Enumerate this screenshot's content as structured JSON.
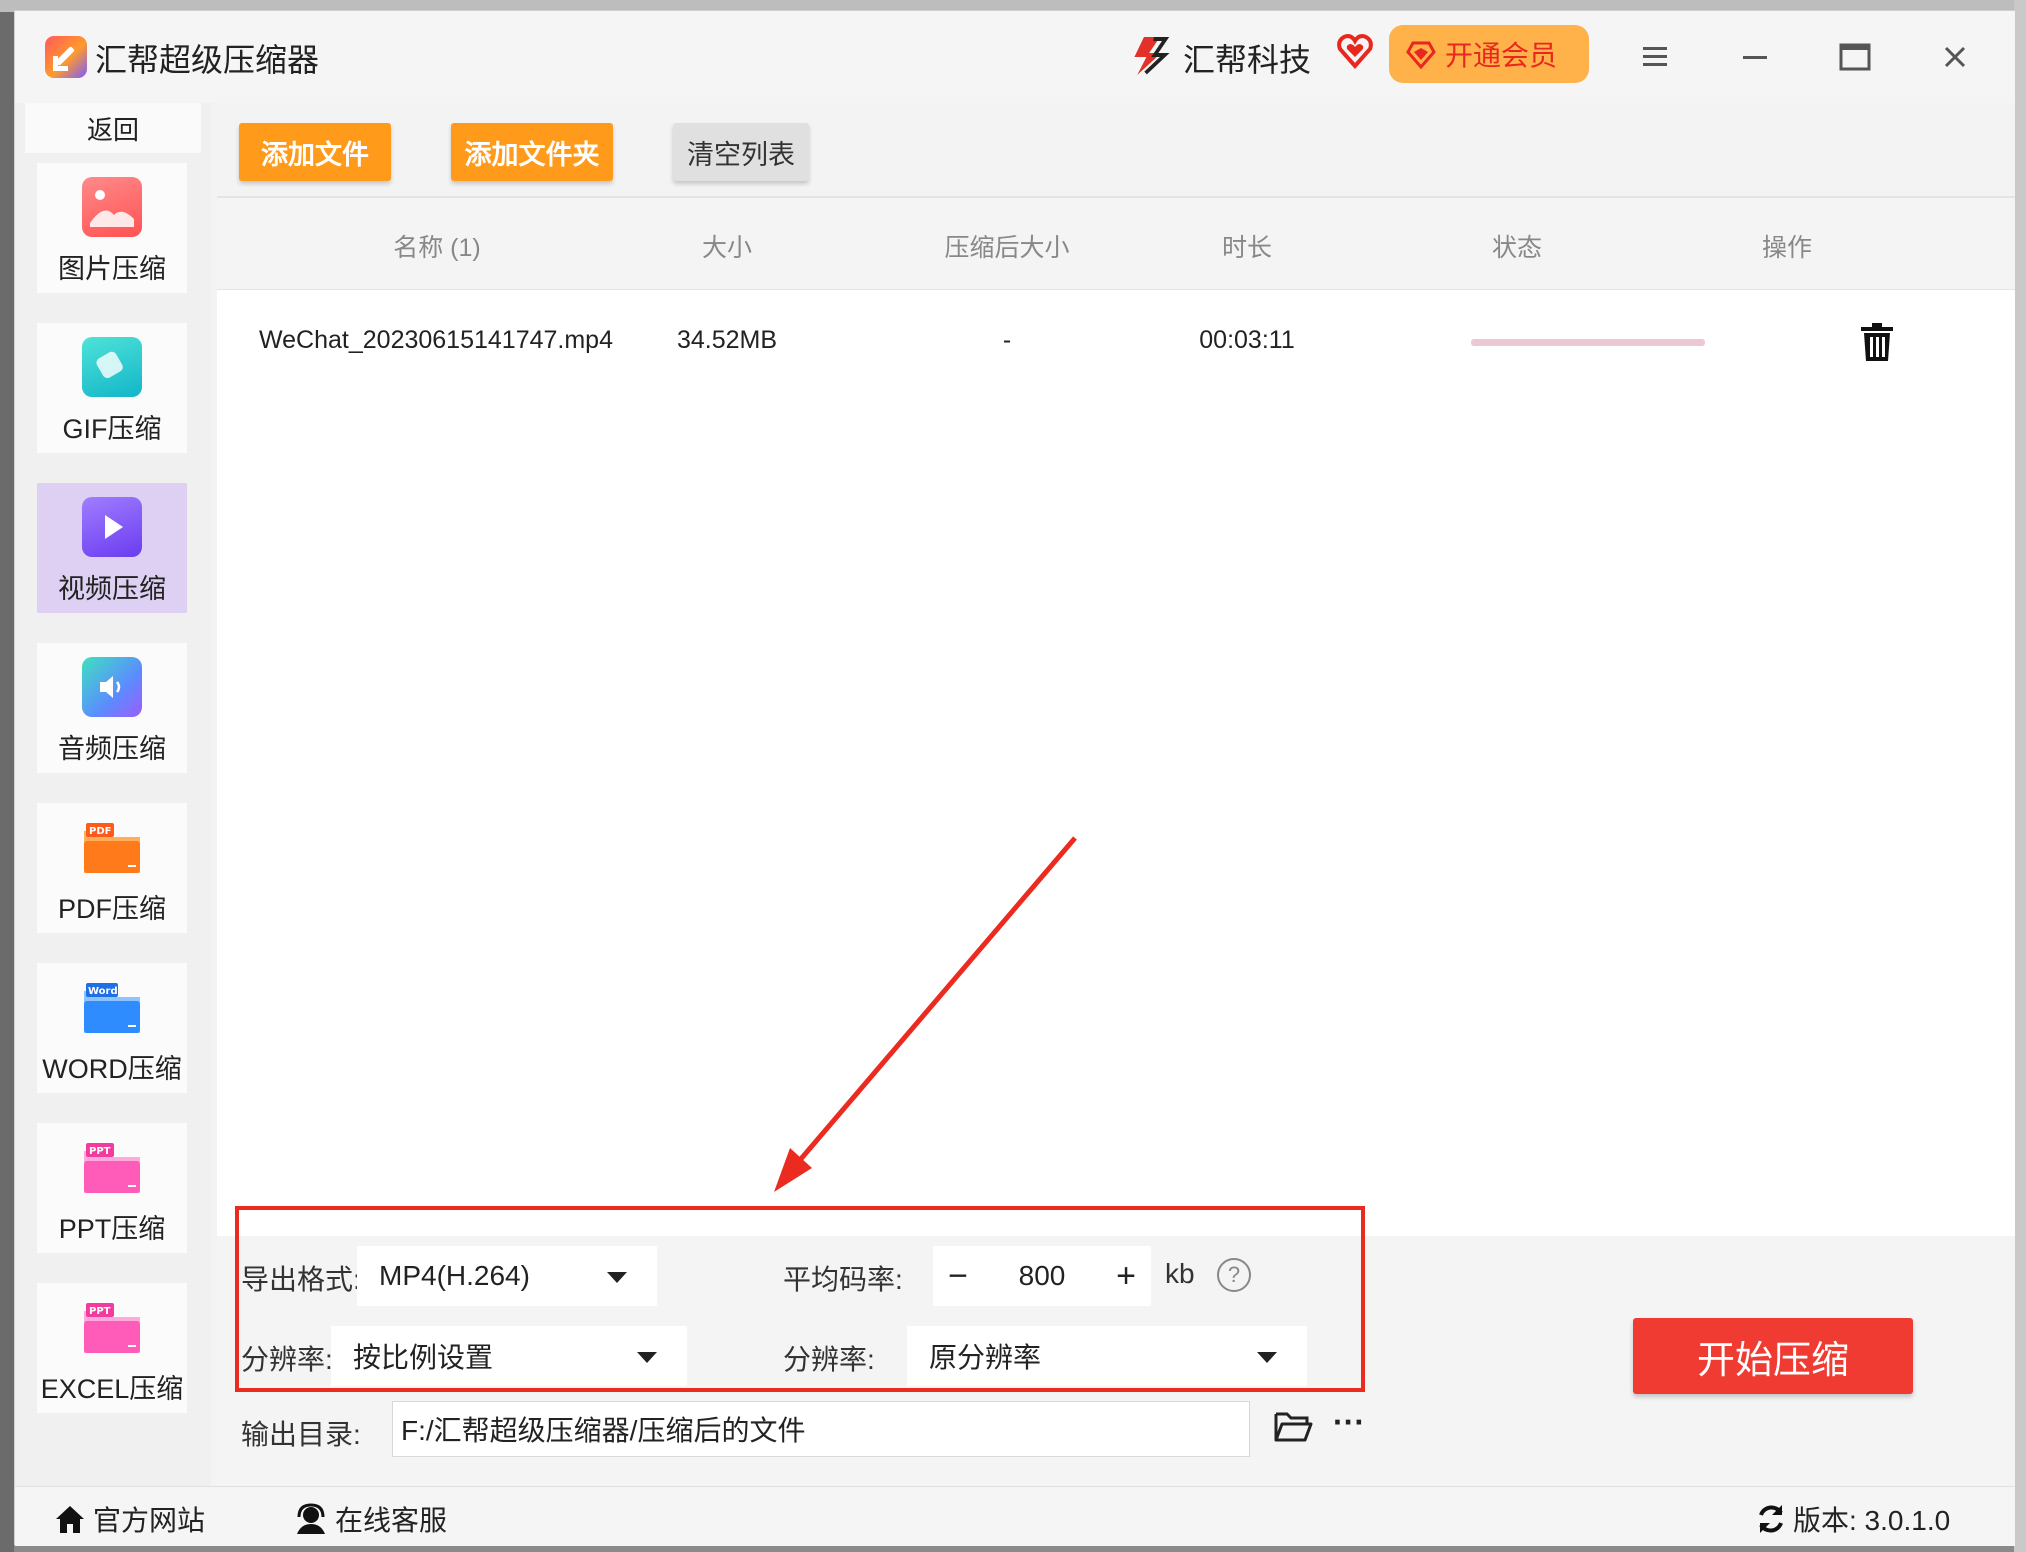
{
  "window": {
    "app_title": "汇帮超级压缩器",
    "brand_name": "汇帮科技",
    "vip_label": "开通会员",
    "icons": {
      "app": "compress-logo-icon",
      "brand": "brand-logo-icon",
      "heart": "heart-icon",
      "vip": "diamond-icon",
      "menu": "menu-icon",
      "minimize": "minimize-icon",
      "maximize": "maximize-icon",
      "close": "close-icon"
    }
  },
  "sidebar": {
    "back_label": "返回",
    "items": [
      {
        "label": "图片压缩",
        "icon": "image-icon",
        "color": "#ff6b6b"
      },
      {
        "label": "GIF压缩",
        "icon": "gif-icon",
        "color": "#1ec8c8"
      },
      {
        "label": "视频压缩",
        "icon": "video-play-icon",
        "color": "#8a5cff",
        "active": true
      },
      {
        "label": "音频压缩",
        "icon": "audio-icon",
        "color": "#4fa8ff"
      },
      {
        "label": "PDF压缩",
        "icon": "pdf-folder-icon",
        "color": "#ff8a1a",
        "badge": "PDF"
      },
      {
        "label": "WORD压缩",
        "icon": "word-folder-icon",
        "color": "#2f8cff",
        "badge": "Word"
      },
      {
        "label": "PPT压缩",
        "icon": "ppt-folder-icon",
        "color": "#ff5bb8",
        "badge": "PPT"
      },
      {
        "label": "EXCEL压缩",
        "icon": "excel-folder-icon",
        "color": "#ff5bb8",
        "badge": "PPT"
      }
    ]
  },
  "toolbar": {
    "add_file": "添加文件",
    "add_folder": "添加文件夹",
    "clear_list": "清空列表"
  },
  "table": {
    "headers": [
      "名称 (1)",
      "大小",
      "压缩后大小",
      "时长",
      "状态",
      "操作"
    ],
    "rows": [
      {
        "name": "WeChat_20230615141747.mp4",
        "size": "34.52MB",
        "compressed_size": "-",
        "duration": "00:03:11",
        "status_progress": 0
      }
    ]
  },
  "settings": {
    "format_label": "导出格式:",
    "format_value": "MP4(H.264)",
    "bitrate_label": "平均码率:",
    "bitrate_value": "800",
    "bitrate_unit": "kb",
    "bitrate_minus": "−",
    "bitrate_plus": "+",
    "help_glyph": "?",
    "resolution_mode_label": "分辨率:",
    "resolution_mode_value": "按比例设置",
    "resolution_label": "分辨率:",
    "resolution_value": "原分辨率",
    "output_label": "输出目录:",
    "output_path": "F:/汇帮超级压缩器/压缩后的文件",
    "more_glyph": "···",
    "start_button": "开始压缩"
  },
  "footer": {
    "website": "官方网站",
    "support": "在线客服",
    "version": "版本: 3.0.1.0"
  },
  "colors": {
    "accent_orange": "#ff9a1a",
    "start_red": "#ef3b32",
    "highlight_frame": "#ec2b20",
    "active_sidebar": "#ddd0f3"
  }
}
